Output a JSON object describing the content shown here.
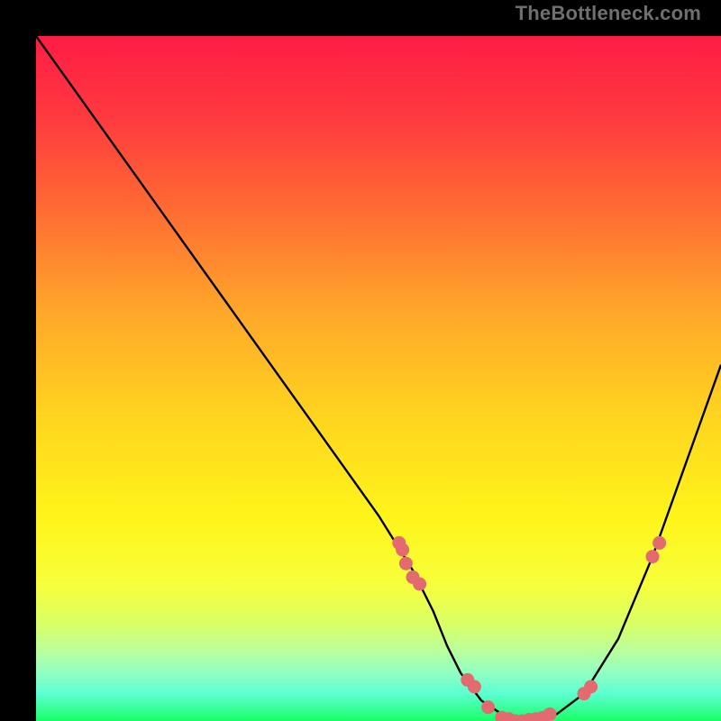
{
  "watermark": "TheBottleneck.com",
  "chart_data": {
    "type": "line",
    "title": "",
    "xlabel": "",
    "ylabel": "",
    "xlim": [
      0,
      100
    ],
    "ylim": [
      0,
      100
    ],
    "grid": false,
    "series": [
      {
        "name": "curve",
        "x": [
          0,
          5,
          10,
          15,
          20,
          25,
          30,
          35,
          40,
          45,
          50,
          55,
          58,
          60,
          62,
          65,
          68,
          70,
          73,
          76,
          80,
          85,
          90,
          95,
          100
        ],
        "y": [
          100,
          93,
          86,
          79,
          72,
          65,
          58,
          51,
          44,
          37,
          30,
          22,
          16,
          11,
          7,
          3,
          1,
          0,
          0,
          1,
          4,
          12,
          24,
          38,
          52
        ]
      }
    ],
    "markers": {
      "name": "highlight-points",
      "x": [
        53,
        53.5,
        54,
        55,
        56,
        63,
        64,
        66,
        68,
        69,
        70,
        71,
        72,
        73,
        74,
        75,
        80,
        81,
        90,
        91
      ],
      "y": [
        26,
        25,
        23,
        21,
        20,
        6,
        5,
        2,
        0.5,
        0.3,
        0,
        0,
        0.2,
        0.3,
        0.5,
        1,
        4,
        5,
        24,
        26
      ]
    },
    "gradient_stops": [
      {
        "offset": 0.0,
        "color": "#ff1c46"
      },
      {
        "offset": 0.12,
        "color": "#ff3a3f"
      },
      {
        "offset": 0.25,
        "color": "#ff6a33"
      },
      {
        "offset": 0.4,
        "color": "#ffa62a"
      },
      {
        "offset": 0.55,
        "color": "#ffd31f"
      },
      {
        "offset": 0.7,
        "color": "#fff41a"
      },
      {
        "offset": 0.8,
        "color": "#f7ff3a"
      },
      {
        "offset": 0.86,
        "color": "#d8ff68"
      },
      {
        "offset": 0.9,
        "color": "#b7ffa0"
      },
      {
        "offset": 0.93,
        "color": "#90ffc2"
      },
      {
        "offset": 0.96,
        "color": "#5cffd2"
      },
      {
        "offset": 1.0,
        "color": "#19ff66"
      }
    ],
    "marker_color": "#e36a6f",
    "curve_color": "#000000"
  }
}
